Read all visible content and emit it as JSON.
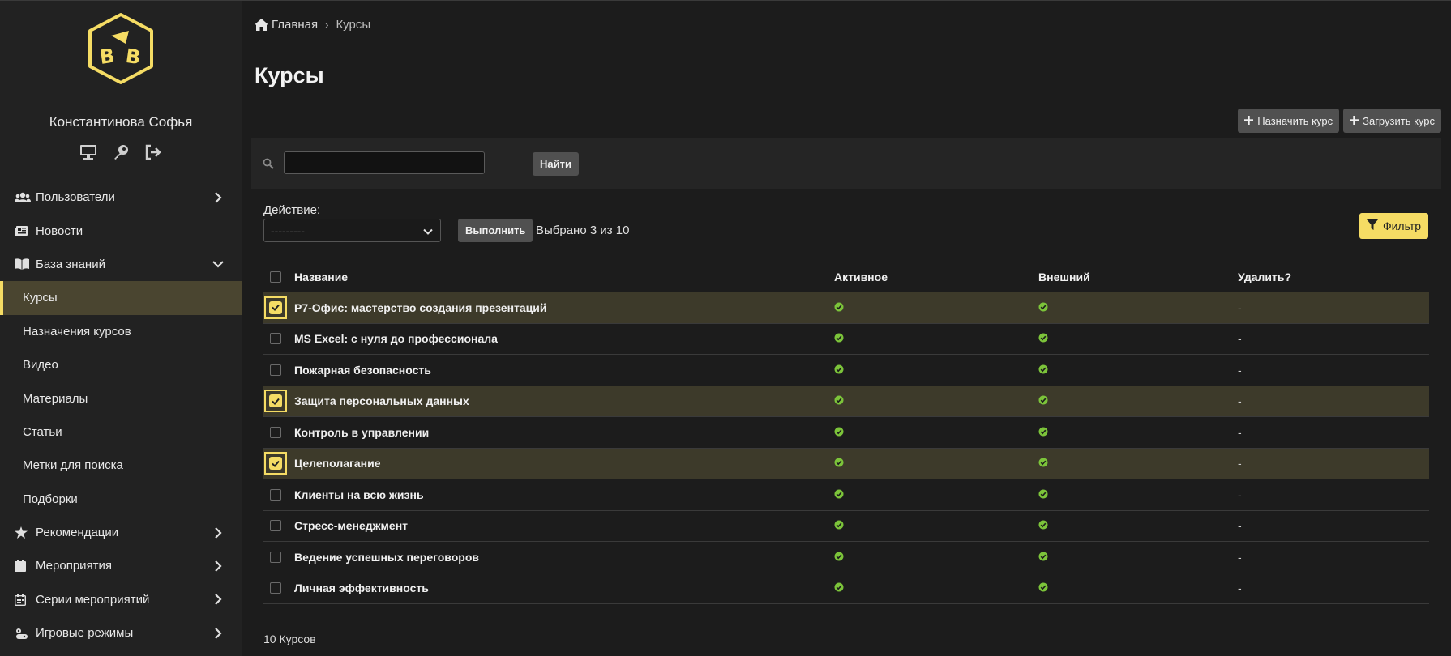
{
  "user": {
    "name": "Константинова Софья"
  },
  "sidebar": {
    "items": [
      {
        "label": "Пользователи",
        "icon": "users-icon",
        "chevron": "right"
      },
      {
        "label": "Новости",
        "icon": "newspaper-icon"
      },
      {
        "label": "База знаний",
        "icon": "book-icon",
        "chevron": "down"
      },
      {
        "label": "Курсы",
        "sub": true,
        "active": true
      },
      {
        "label": "Назначения курсов",
        "sub": true
      },
      {
        "label": "Видео",
        "sub": true
      },
      {
        "label": "Материалы",
        "sub": true
      },
      {
        "label": "Статьи",
        "sub": true
      },
      {
        "label": "Метки для поиска",
        "sub": true
      },
      {
        "label": "Подборки",
        "sub": true
      },
      {
        "label": "Рекомендации",
        "icon": "star-icon",
        "chevron": "right"
      },
      {
        "label": "Мероприятия",
        "icon": "calendar-icon",
        "chevron": "right"
      },
      {
        "label": "Серии мероприятий",
        "icon": "calendar-grid-icon",
        "chevron": "right"
      },
      {
        "label": "Игровые режимы",
        "icon": "gamepad-icon",
        "chevron": "right"
      }
    ]
  },
  "breadcrumb": {
    "home": "Главная",
    "current": "Курсы"
  },
  "page": {
    "title": "Курсы"
  },
  "toolbar": {
    "assign_label": "Назначить курс",
    "upload_label": "Загрузить курс"
  },
  "search": {
    "value": "",
    "button_label": "Найти"
  },
  "actions": {
    "label": "Действие:",
    "selected": "---------",
    "run_label": "Выполнить",
    "selection_status": "Выбрано 3 из 10",
    "filter_label": "Фильтр"
  },
  "table": {
    "headers": {
      "name": "Название",
      "active": "Активное",
      "external": "Внешний",
      "delete": "Удалить?"
    },
    "rows": [
      {
        "name": "Р7-Офис: мастерство создания презентаций",
        "selected": true,
        "del": "-"
      },
      {
        "name": "MS Excel: с нуля до профессионала",
        "selected": false,
        "del": "-"
      },
      {
        "name": "Пожарная безопасность",
        "selected": false,
        "del": "-"
      },
      {
        "name": "Защита персональных данных",
        "selected": true,
        "del": "-"
      },
      {
        "name": "Контроль в управлении",
        "selected": false,
        "del": "-"
      },
      {
        "name": "Целеполагание",
        "selected": true,
        "del": "-"
      },
      {
        "name": "Клиенты на всю жизнь",
        "selected": false,
        "del": "-"
      },
      {
        "name": "Стресс-менеджмент",
        "selected": false,
        "del": "-"
      },
      {
        "name": "Ведение успешных переговоров",
        "selected": false,
        "del": "-"
      },
      {
        "name": "Личная эффективность",
        "selected": false,
        "del": "-"
      }
    ],
    "footer": "10 Курсов"
  },
  "colors": {
    "accent": "#f5dc64",
    "check_green": "#7cc43a",
    "selected_row": "#3d3a2a",
    "sidebar_active": "#4a4530"
  }
}
